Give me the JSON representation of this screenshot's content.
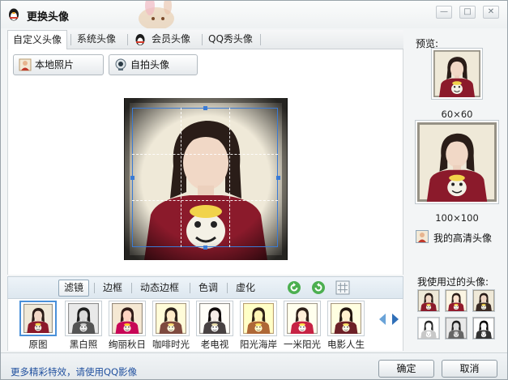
{
  "window": {
    "title": "更换头像",
    "buttons": {
      "minimize": "—",
      "maximize": "□",
      "close": "✕"
    }
  },
  "tabs": [
    {
      "label": "自定义头像",
      "active": true
    },
    {
      "label": "系统头像",
      "active": false
    },
    {
      "label": "会员头像",
      "active": false
    },
    {
      "label": "QQ秀头像",
      "active": false
    }
  ],
  "actions": {
    "local_photo": "本地照片",
    "selfie": "自拍头像"
  },
  "filter_tabs": [
    {
      "label": "滤镜",
      "active": true
    },
    {
      "label": "边框",
      "active": false
    },
    {
      "label": "动态边框",
      "active": false
    },
    {
      "label": "色调",
      "active": false
    },
    {
      "label": "虚化",
      "active": false
    }
  ],
  "filters": [
    {
      "label": "原图",
      "active": true,
      "tint": "#cfe3f0",
      "shirt": "#8b1a2b"
    },
    {
      "label": "黑白照",
      "active": false,
      "tint": "#d9d9d9",
      "shirt": "#555555"
    },
    {
      "label": "绚丽秋日",
      "active": false,
      "tint": "#f2d6c3",
      "shirt": "#a0153a"
    },
    {
      "label": "咖啡时光",
      "active": false,
      "tint": "#eadbc8",
      "shirt": "#8a3a36"
    },
    {
      "label": "老电视",
      "active": false,
      "tint": "#d2d0cc",
      "shirt": "#5a4a4a"
    },
    {
      "label": "阳光海岸",
      "active": false,
      "tint": "#f3df9a",
      "shirt": "#b0522a"
    },
    {
      "label": "一米阳光",
      "active": false,
      "tint": "#f4e7e9",
      "shirt": "#b4203e"
    },
    {
      "label": "电影人生",
      "active": false,
      "tint": "#e6e3b8",
      "shirt": "#7c1d2c"
    }
  ],
  "preview": {
    "label": "预览:",
    "small_size": "60×60",
    "large_size": "100×100"
  },
  "hd_avatar_label": "我的高清头像",
  "used_avatars_label": "我使用过的头像:",
  "footer": {
    "tip": "更多精彩特效，请使用QQ影像",
    "ok": "确定",
    "cancel": "取消"
  },
  "colors": {
    "accent": "#3a7bd5",
    "link": "#1f4f9e",
    "shirt": "#8b1a2b",
    "refresh_green": "#4caf50"
  }
}
